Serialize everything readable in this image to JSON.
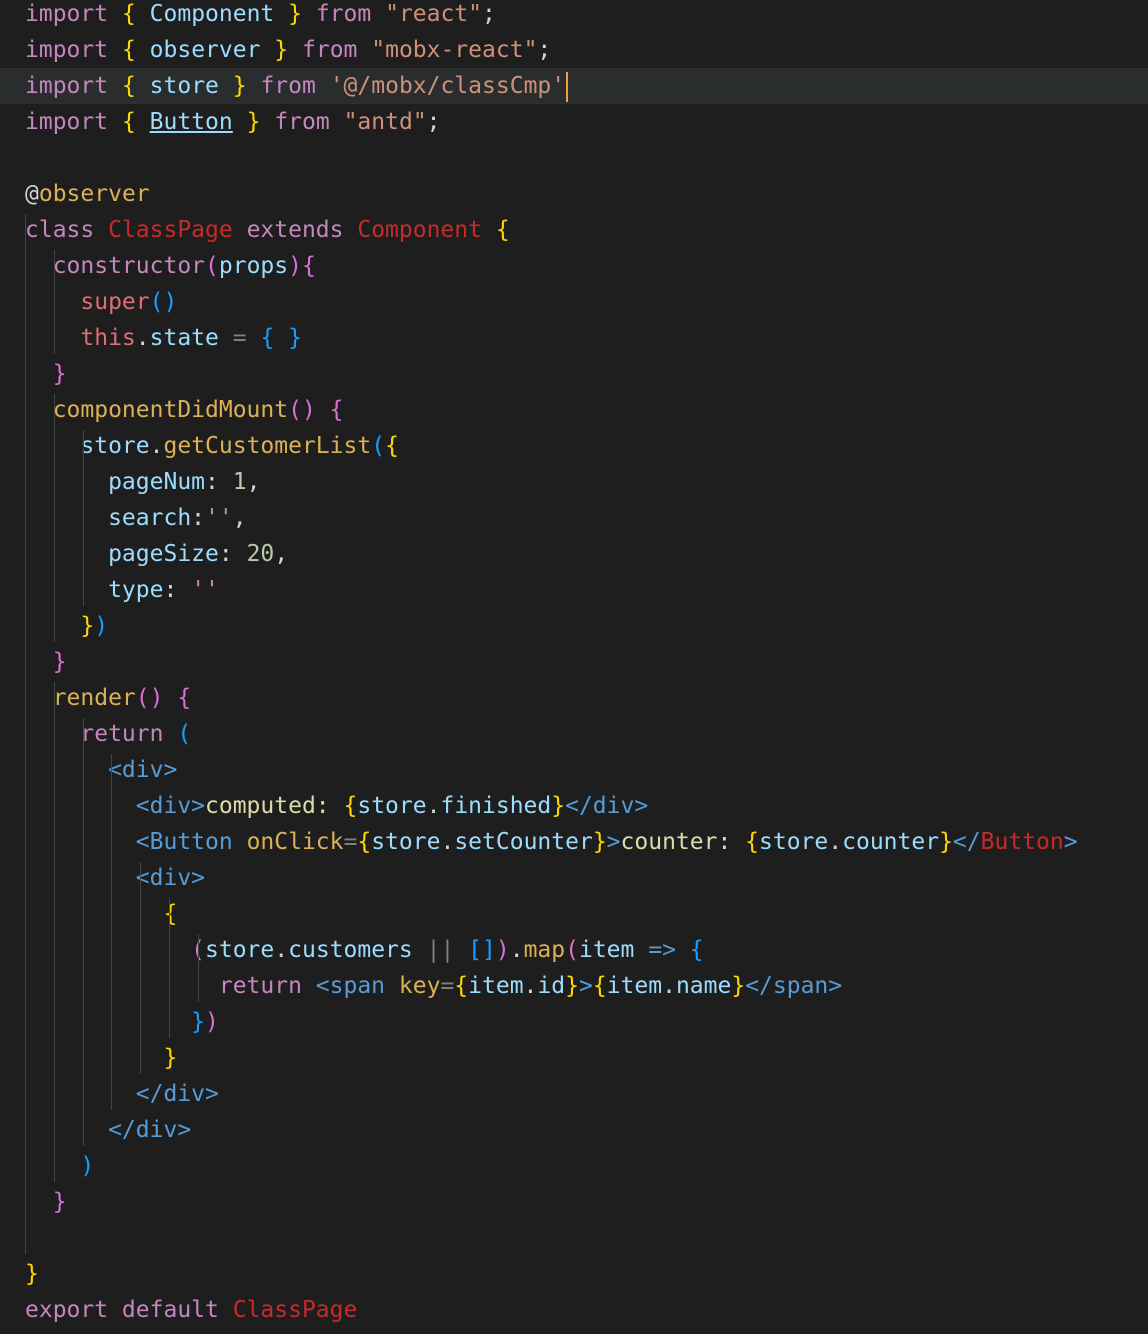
{
  "colors": {
    "background": "#1e1e1e",
    "keyword": "#c586c0",
    "variable": "#9cdcfe",
    "string": "#ce9178",
    "class_name": "#c72a2a",
    "function": "#dcb056",
    "bracket_gold": "#ffd700",
    "bracket_purple": "#da70d6",
    "bracket_blue": "#179fff",
    "tag": "#808080",
    "plain": "#d4d4d4",
    "cursor": "#f0a23a"
  },
  "editor": {
    "current_line": 3,
    "lines": [
      [
        [
          "import",
          "kw"
        ],
        [
          " ",
          ""
        ],
        [
          "{",
          "b1"
        ],
        [
          " Component ",
          "var"
        ],
        [
          "}",
          "b1"
        ],
        [
          " from ",
          "kw"
        ],
        [
          "\"react\"",
          "str"
        ],
        [
          ";",
          "pl"
        ]
      ],
      [
        [
          "import",
          "kw"
        ],
        [
          " ",
          ""
        ],
        [
          "{",
          "b1"
        ],
        [
          " observer ",
          "var"
        ],
        [
          "}",
          "b1"
        ],
        [
          " from ",
          "kw"
        ],
        [
          "\"mobx-react\"",
          "str"
        ],
        [
          ";",
          "pl"
        ]
      ],
      [
        [
          "import",
          "kw"
        ],
        [
          " ",
          ""
        ],
        [
          "{",
          "b1"
        ],
        [
          " store ",
          "var"
        ],
        [
          "}",
          "b1"
        ],
        [
          " from ",
          "kw"
        ],
        [
          "'@/mobx/classCmp'",
          "str"
        ]
      ],
      [
        [
          "import",
          "kw"
        ],
        [
          " ",
          ""
        ],
        [
          "{",
          "b1"
        ],
        [
          " ",
          ""
        ],
        [
          "Button",
          "var ul"
        ],
        [
          " ",
          ""
        ],
        [
          "}",
          "b1"
        ],
        [
          " from ",
          "kw"
        ],
        [
          "\"antd\"",
          "str"
        ],
        [
          ";",
          "pl"
        ]
      ],
      [],
      [
        [
          "@",
          "pl"
        ],
        [
          "observer",
          "fn"
        ]
      ],
      [
        [
          "class ",
          "kw"
        ],
        [
          "ClassPage",
          "cls"
        ],
        [
          " extends ",
          "kw"
        ],
        [
          "Component",
          "cls"
        ],
        [
          " ",
          ""
        ],
        [
          "{",
          "b1"
        ]
      ],
      [
        [
          "  constructor",
          "kw"
        ],
        [
          "(",
          "b2"
        ],
        [
          "props",
          "var"
        ],
        [
          ")",
          "b2"
        ],
        [
          "{",
          "b2"
        ]
      ],
      [
        [
          "    super",
          "cls2"
        ],
        [
          "()",
          "b3"
        ]
      ],
      [
        [
          "    this",
          "cls2"
        ],
        [
          ".",
          "pl"
        ],
        [
          "state",
          "var"
        ],
        [
          " = ",
          "tag"
        ],
        [
          "{",
          "b3"
        ],
        [
          " ",
          ""
        ],
        [
          "}",
          "b3"
        ]
      ],
      [
        [
          "  }",
          "b2"
        ]
      ],
      [
        [
          "  componentDidMount",
          "fn"
        ],
        [
          "()",
          "b2"
        ],
        [
          " ",
          ""
        ],
        [
          "{",
          "b2"
        ]
      ],
      [
        [
          "    store",
          "var"
        ],
        [
          ".",
          "pl"
        ],
        [
          "getCustomerList",
          "fn"
        ],
        [
          "(",
          "b3"
        ],
        [
          "{",
          "b1"
        ]
      ],
      [
        [
          "      pageNum",
          "var"
        ],
        [
          ": ",
          "pl"
        ],
        [
          "1",
          "num"
        ],
        [
          ",",
          "pl"
        ]
      ],
      [
        [
          "      search",
          "var"
        ],
        [
          ":",
          "pl"
        ],
        [
          "''",
          "str"
        ],
        [
          ",",
          "pl"
        ]
      ],
      [
        [
          "      pageSize",
          "var"
        ],
        [
          ": ",
          "pl"
        ],
        [
          "20",
          "num"
        ],
        [
          ",",
          "pl"
        ]
      ],
      [
        [
          "      type",
          "var"
        ],
        [
          ": ",
          "pl"
        ],
        [
          "''",
          "str"
        ]
      ],
      [
        [
          "    }",
          "b1"
        ],
        [
          ")",
          "b3"
        ]
      ],
      [
        [
          "  }",
          "b2"
        ]
      ],
      [
        [
          "  render",
          "fn"
        ],
        [
          "()",
          "b2"
        ],
        [
          " ",
          ""
        ],
        [
          "{",
          "b2"
        ]
      ],
      [
        [
          "    return ",
          "kw"
        ],
        [
          "(",
          "b3"
        ]
      ],
      [
        [
          "      <div>",
          "tag2"
        ]
      ],
      [
        [
          "        <div>",
          "tag2"
        ],
        [
          "computed: ",
          "yel"
        ],
        [
          "{",
          "b1"
        ],
        [
          "store",
          "var"
        ],
        [
          ".",
          "pl"
        ],
        [
          "finished",
          "var"
        ],
        [
          "}",
          "b1"
        ],
        [
          "</div>",
          "tag2"
        ]
      ],
      [
        [
          "        <Button",
          "tag2"
        ],
        [
          " onClick",
          "fn"
        ],
        [
          "=",
          "tag"
        ],
        [
          "{",
          "b1"
        ],
        [
          "store",
          "var"
        ],
        [
          ".",
          "pl"
        ],
        [
          "setCounter",
          "var"
        ],
        [
          "}",
          "b1"
        ],
        [
          ">",
          "tag2"
        ],
        [
          "counter: ",
          "yel"
        ],
        [
          "{",
          "b1"
        ],
        [
          "store",
          "var"
        ],
        [
          ".",
          "pl"
        ],
        [
          "counter",
          "var"
        ],
        [
          "}",
          "b1"
        ],
        [
          "</",
          "tag2"
        ],
        [
          "Button",
          "cls"
        ],
        [
          ">",
          "tag2"
        ]
      ],
      [
        [
          "        <div>",
          "tag2"
        ]
      ],
      [
        [
          "          {",
          "b1"
        ]
      ],
      [
        [
          "            (",
          "b2"
        ],
        [
          "store",
          "var"
        ],
        [
          ".",
          "pl"
        ],
        [
          "customers",
          "var"
        ],
        [
          " || ",
          "tag"
        ],
        [
          "[]",
          "b3"
        ],
        [
          ")",
          "b2"
        ],
        [
          ".",
          "pl"
        ],
        [
          "map",
          "fn"
        ],
        [
          "(",
          "b2"
        ],
        [
          "item ",
          "var"
        ],
        [
          "=>",
          "tag2"
        ],
        [
          " ",
          ""
        ],
        [
          "{",
          "b3"
        ]
      ],
      [
        [
          "              return ",
          "kw"
        ],
        [
          "<span",
          "tag2"
        ],
        [
          " key",
          "fn"
        ],
        [
          "=",
          "tag"
        ],
        [
          "{",
          "b1"
        ],
        [
          "item",
          "var"
        ],
        [
          ".",
          "pl"
        ],
        [
          "id",
          "var"
        ],
        [
          "}",
          "b1"
        ],
        [
          ">",
          "tag2"
        ],
        [
          "{",
          "b1"
        ],
        [
          "item",
          "var"
        ],
        [
          ".",
          "pl"
        ],
        [
          "name",
          "var"
        ],
        [
          "}",
          "b1"
        ],
        [
          "</span>",
          "tag2"
        ]
      ],
      [
        [
          "            }",
          "b3"
        ],
        [
          ")",
          "b2"
        ]
      ],
      [
        [
          "          }",
          "b1"
        ]
      ],
      [
        [
          "        </div>",
          "tag2"
        ]
      ],
      [
        [
          "      </div>",
          "tag2"
        ]
      ],
      [
        [
          "    )",
          "b3"
        ]
      ],
      [
        [
          "  }",
          "b2"
        ]
      ],
      [],
      [
        [
          "}",
          "b1"
        ]
      ],
      [
        [
          "export default ",
          "kw"
        ],
        [
          "ClassPage",
          "cls"
        ]
      ]
    ]
  }
}
